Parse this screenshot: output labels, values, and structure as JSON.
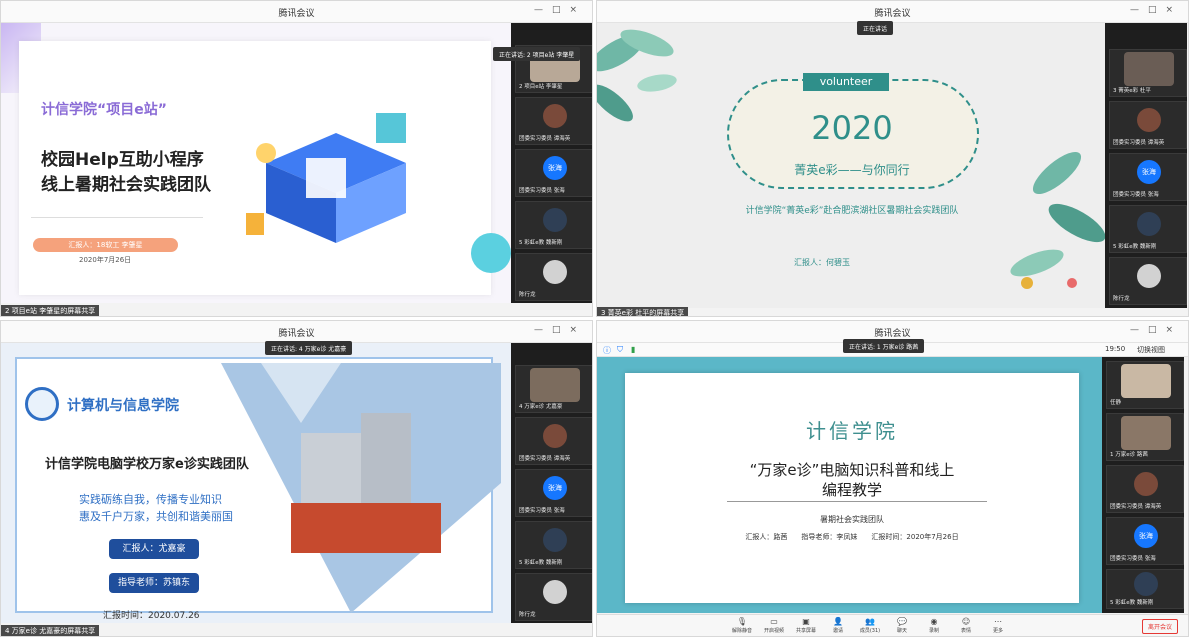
{
  "windows": [
    {
      "title": "腾讯会议",
      "speaking": "正在讲话: 2 项目e站 李肇星",
      "share_label": "2 项目e站 李肇星的屏幕共享",
      "slide": {
        "org": "计信学院“项目e站”",
        "title_line1": "校园Help互助小程序",
        "title_line2": "线上暑期社会实践团队",
        "reporter": "汇报人：18软工 李肇星",
        "date": "2020年7月26日"
      },
      "tiles": [
        "2 项目e站 李肇星",
        "团委实习委员 谭海英",
        "团委实习委员 张海",
        "5 彩虹e教 魏新刚",
        "陈行龙"
      ],
      "blue_avatar": "张海"
    },
    {
      "title": "腾讯会议",
      "speaking": "正在讲话",
      "share_label": "3 菁英e彩 杜平的屏幕共享",
      "slide": {
        "badge": "volunteer",
        "year": "2020",
        "slogan": "菁英e彩——与你同行",
        "subtitle": "计信学院“菁英e彩”赴合肥滨湖社区暑期社会实践团队",
        "reporter": "汇报人：何碧玉"
      },
      "tiles": [
        "3 菁英e彩 杜平",
        "团委实习委员 谭海英",
        "团委实习委员 张海",
        "5 彩虹e教 魏新刚",
        "陈行龙"
      ],
      "blue_avatar": "张海"
    },
    {
      "title": "腾讯会议",
      "speaking": "正在讲话: 4 万家e诊 尤嘉豪",
      "share_label": "4 万家e诊 尤嘉豪的屏幕共享",
      "slide": {
        "school": "计算机与信息学院",
        "title": "计信学院电脑学校万家e诊实践团队",
        "motto1": "实践砺练自我，传播专业知识",
        "motto2": "惠及千户万家，共创和谐美丽国",
        "reporter": "汇报人：尤嘉豪",
        "advisor": "指导老师：苏镇东",
        "date": "汇报时间：2020.07.26"
      },
      "tiles": [
        "4 万家e诊 尤嘉豪",
        "团委实习委员 谭海英",
        "团委实习委员 张海",
        "5 彩虹e教 魏新刚",
        "陈行龙"
      ],
      "blue_avatar": "张海"
    },
    {
      "title": "腾讯会议",
      "speaking": "正在讲话: 1 万家e诊 路茜",
      "time": "19:50",
      "switch_view": "切换视图",
      "slide": {
        "org": "计信学院",
        "title_line1": "“万家e诊”电脑知识科普和线上",
        "title_line2": "编程教学",
        "team": "暑期社会实践团队",
        "info": "汇报人：路茜　　指导老师：李凤妹　　汇报时间：2020年7月26日"
      },
      "tiles": [
        "任静",
        "1 万家e诊 路茜",
        "团委实习委员 谭海英",
        "团委实习委员 张海",
        "5 彩虹e教 魏新刚"
      ],
      "blue_avatar": "张海",
      "toolbar": [
        "解除静音",
        "开启视频",
        "共享屏幕",
        "邀请",
        "成员(31)",
        "聊天",
        "录制",
        "表情",
        "更多"
      ],
      "leave": "离开会议"
    }
  ]
}
